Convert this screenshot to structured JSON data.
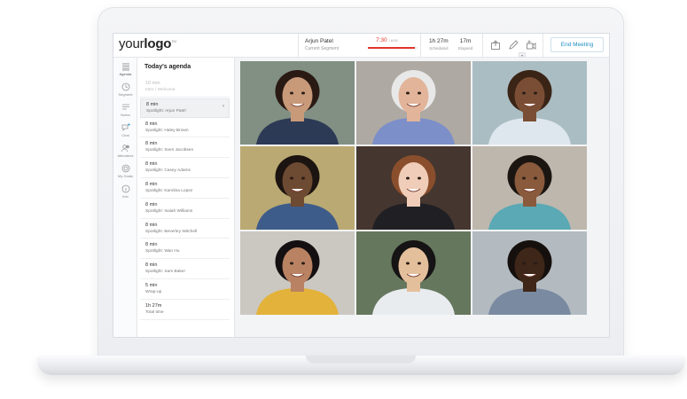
{
  "topbar": {
    "logo_light": "your",
    "logo_bold": "logo",
    "logo_tm": "TM",
    "presenter_name": "Arjun Patel",
    "presenter_sub": "Current Segment",
    "timer_value": "7:30",
    "timer_of": "/ 8:00",
    "timer_progress": 0.94,
    "scheduled_value": "1h 27m",
    "scheduled_label": "Scheduled",
    "elapsed_value": "17m",
    "elapsed_label": "Elapsed",
    "end_button": "End Meeting",
    "accent_color": "#e0342b",
    "link_color": "#1f8fc4"
  },
  "nav": [
    {
      "label": "Agenda",
      "icon": "list-icon"
    },
    {
      "label": "Segment",
      "icon": "clock-icon"
    },
    {
      "label": "Notes",
      "icon": "notes-icon"
    },
    {
      "label": "Chat",
      "icon": "chat-icon"
    },
    {
      "label": "Attendees",
      "icon": "attendees-icon"
    },
    {
      "label": "My Goals",
      "icon": "target-icon"
    },
    {
      "label": "Info",
      "icon": "info-icon"
    }
  ],
  "agenda": {
    "title": "Today's agenda",
    "items": [
      {
        "time": "10 min",
        "desc": "Intro / Welcome"
      },
      {
        "time": "8 min",
        "desc": "Spotlight: Arjun Patel"
      },
      {
        "time": "8 min",
        "desc": "Spotlight: Haley Brown"
      },
      {
        "time": "8 min",
        "desc": "Spotlight: Sven Jacobsen"
      },
      {
        "time": "8 min",
        "desc": "Spotlight: Casey Adams"
      },
      {
        "time": "8 min",
        "desc": "Spotlight: Karolina Lopez"
      },
      {
        "time": "8 min",
        "desc": "Spotlight: Isaiah Williams"
      },
      {
        "time": "8 min",
        "desc": "Spotlight: Beverley Witchell"
      },
      {
        "time": "8 min",
        "desc": "Spotlight: Wan Hu"
      },
      {
        "time": "8 min",
        "desc": "Spotlight: Sam Baker"
      },
      {
        "time": "5 min",
        "desc": "Wrap-up"
      },
      {
        "time": "1h 27m",
        "desc": "Total time"
      }
    ]
  },
  "video_tiles": [
    {
      "bg": "#8a9a8c",
      "skin": "#c89a7a",
      "hair": "#2a1a14",
      "shirt": "#2d3a55"
    },
    {
      "bg": "#b9b4ad",
      "skin": "#e2b49a",
      "hair": "#e8e8e8",
      "shirt": "#7d8fc9"
    },
    {
      "bg": "#b5c9cf",
      "skin": "#7a4e35",
      "hair": "#3a2416",
      "shirt": "#dfe7ee"
    },
    {
      "bg": "#c6b47a",
      "skin": "#6d4a32",
      "hair": "#1c1410",
      "shirt": "#3e5c8a"
    },
    {
      "bg": "#4a3a32",
      "skin": "#f0cdb8",
      "hair": "#8a4e2c",
      "shirt": "#1f1f24"
    },
    {
      "bg": "#c9c3b8",
      "skin": "#8a5a3c",
      "hair": "#1b1512",
      "shirt": "#5aa9b5"
    },
    {
      "bg": "#d8d5cf",
      "skin": "#b98262",
      "hair": "#141011",
      "shirt": "#e2b23a"
    },
    {
      "bg": "#6c7f63",
      "skin": "#e4bf9c",
      "hair": "#151313",
      "shirt": "#e9ecef"
    },
    {
      "bg": "#bfc7ce",
      "skin": "#3e2618",
      "hair": "#15100d",
      "shirt": "#7a8aa1"
    }
  ]
}
